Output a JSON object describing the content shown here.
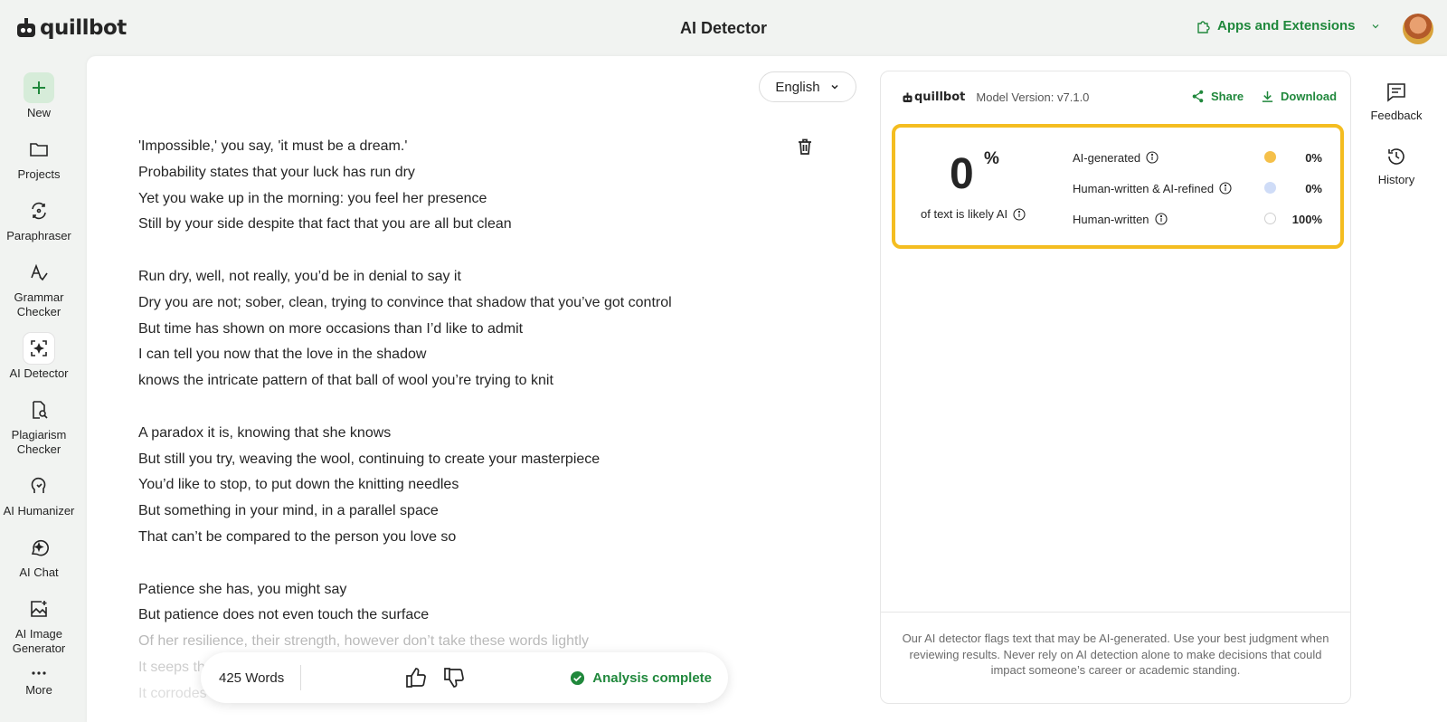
{
  "app": {
    "logo_text": "quillbot",
    "page_title": "AI Detector",
    "apps_label": "Apps and Extensions"
  },
  "left_nav": [
    {
      "label": "New",
      "icon": "plus-icon"
    },
    {
      "label": "Projects",
      "icon": "folder-icon"
    },
    {
      "label": "Paraphraser",
      "icon": "paraphraser-icon"
    },
    {
      "label": "Grammar Checker",
      "icon": "grammar-icon"
    },
    {
      "label": "AI Detector",
      "icon": "ai-detector-icon"
    },
    {
      "label": "Plagiarism Checker",
      "icon": "plagiarism-icon"
    },
    {
      "label": "AI Humanizer",
      "icon": "humanizer-icon"
    },
    {
      "label": "AI Chat",
      "icon": "chat-icon"
    },
    {
      "label": "AI Image Generator",
      "icon": "image-generator-icon"
    },
    {
      "label": "More",
      "icon": "more-dots-icon"
    }
  ],
  "editor": {
    "language": "English",
    "lines": [
      "'Impossible,' you say, 'it must be a dream.'",
      "Probability states that your luck has run dry",
      "Yet you wake up in the morning: you feel her presence",
      "Still by your side despite that fact that you are all but clean",
      "",
      "Run dry, well, not really, you’d be in denial to say it",
      "Dry you are not; sober, clean, trying to convince that shadow that you’ve got control",
      "But time has shown on more occasions than I’d like to admit",
      "I can tell you now that the love in the shadow",
      "knows the intricate pattern of that ball of wool you’re trying to knit",
      "",
      "A paradox it is, knowing that she knows",
      "But still you try, weaving the wool, continuing to create your masterpiece",
      "You’d like to stop, to put down the knitting needles",
      "But something in your mind, in a parallel space",
      "That can’t be compared to the person you love so",
      "",
      "Patience she has, you might say",
      "But patience does not even touch the surface",
      "Of her resilience, their strength, however don’t take these words lightly",
      "It seeps th",
      "It corrodes and erodes your will in every way, so silently"
    ]
  },
  "status": {
    "word_count": "425 Words",
    "analysis": "Analysis complete"
  },
  "results": {
    "logo_text": "quillbot",
    "model_version": "Model Version: v7.1.0",
    "share": "Share",
    "download": "Download",
    "score": "0",
    "score_unit": "%",
    "score_label": "of text is likely AI",
    "breakdown": [
      {
        "label": "AI-generated",
        "value": "0%",
        "color": "#f5c04a"
      },
      {
        "label": "Human-written & AI-refined",
        "value": "0%",
        "color": "#cfdcf7"
      },
      {
        "label": "Human-written",
        "value": "100%",
        "color": "#ffffff"
      }
    ],
    "disclaimer": "Our AI detector flags text that may be AI-generated. Use your best judgment when reviewing results. Never rely on AI detection alone to make decisions that could impact someone’s career or academic standing."
  },
  "right_rail": [
    {
      "label": "Feedback",
      "icon": "feedback-icon"
    },
    {
      "label": "History",
      "icon": "history-icon"
    }
  ],
  "colors": {
    "brand_green": "#20883c",
    "highlight_yellow": "#f4bd20"
  }
}
